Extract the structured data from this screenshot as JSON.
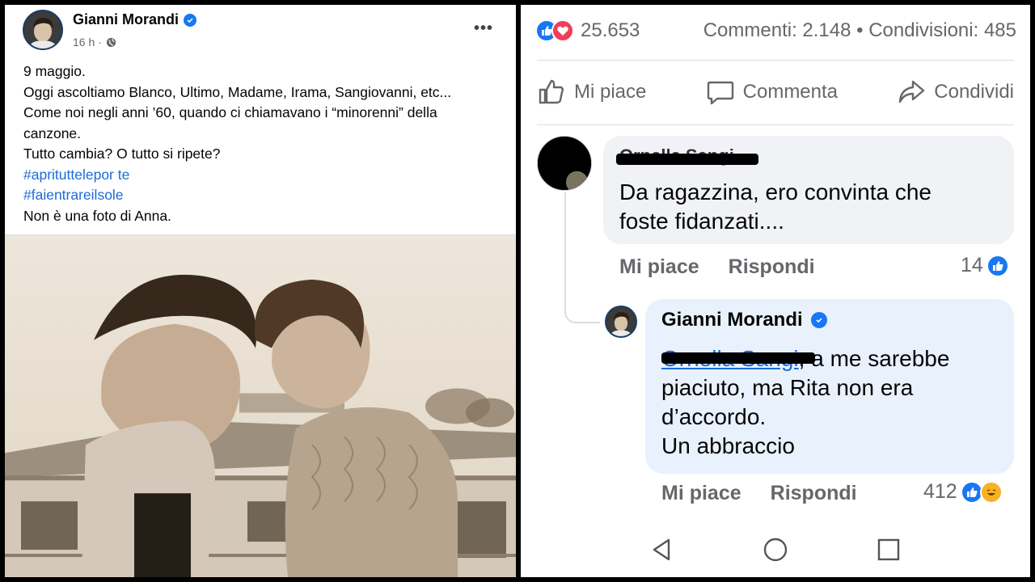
{
  "post": {
    "author": "Gianni Morandi",
    "time": "16 h ·",
    "more_label": "•••",
    "lines": [
      "9 maggio.",
      "Oggi ascoltiamo Blanco, Ultimo, Madame, Irama, Sangiovanni, etc...",
      "Come noi negli anni ’60, quando ci chiamavano i “minorenni” della",
      "canzone.",
      "Tutto cambia? O tutto si ripete?"
    ],
    "hashtags": [
      "#aprituttelepor te",
      "#faientrareilsole"
    ],
    "last_line": "Non è una foto di Anna."
  },
  "stats": {
    "reactions_count": "25.653",
    "comments_shares": "Commenti: 2.148 • Condivisioni: 485"
  },
  "actions": {
    "like": "Mi piace",
    "comment": "Commenta",
    "share": "Condividi"
  },
  "comment1": {
    "author": "Ornella Sangi",
    "text_line1": "Da ragazzina,  ero convinta che",
    "text_line2": "foste fidanzati....",
    "like_label": "Mi piace",
    "reply_label": "Rispondi",
    "reaction_count": "14"
  },
  "reply": {
    "author": "Gianni Morandi",
    "mention": "Ornella Sangi",
    "text_line1": ", a me sarebbe",
    "text_line2": "piaciuto, ma Rita non era",
    "text_line3": "d’accordo.",
    "text_line4": "Un abbraccio",
    "like_label": "Mi piace",
    "reply_label": "Rispondi",
    "reaction_count": "412"
  },
  "colors": {
    "facebook_blue": "#1877f2",
    "link_blue": "#1c6bd6",
    "muted_gray": "#65676b",
    "reply_bubble": "#e9f1fd",
    "comment_bubble": "#f0f2f5"
  }
}
